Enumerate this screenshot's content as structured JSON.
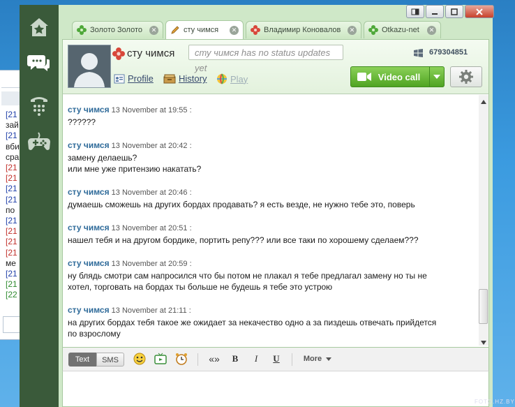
{
  "app": {
    "accent_green": "#5fb42f",
    "sidebar_color": "#3a5a3a",
    "nav": [
      {
        "name": "favorites-icon"
      },
      {
        "name": "chats-icon"
      },
      {
        "name": "phone-icon"
      },
      {
        "name": "games-icon"
      }
    ]
  },
  "tabs": [
    {
      "label": "Золото Золото",
      "icon": "status-online-icon",
      "active": false
    },
    {
      "label": "сту чимся",
      "icon": "pencil-icon",
      "active": true
    },
    {
      "label": "Владимир Коновалов",
      "icon": "status-busy-icon",
      "active": false
    },
    {
      "label": "Otkazu-net",
      "icon": "status-online-icon",
      "active": false
    }
  ],
  "contact": {
    "name": "сту чимся",
    "status_placeholder": "сту чимся has no status updates yet",
    "phone": "679304851",
    "links": {
      "profile": "Profile",
      "history": "History",
      "play": "Play"
    },
    "video_call": "Video call"
  },
  "messages": [
    {
      "author": "сту чимся",
      "time": "13 November at 19:55 :",
      "lines": [
        "??????"
      ]
    },
    {
      "author": "сту чимся",
      "time": "13 November at 20:42 :",
      "lines": [
        "замену делаешь?",
        "или мне уже притензию накатать?"
      ]
    },
    {
      "author": "сту чимся",
      "time": "13 November at 20:46 :",
      "lines": [
        "думаешь сможешь на других бордах продавать? я есть везде, не нужно тебе это, поверь"
      ]
    },
    {
      "author": "сту чимся",
      "time": "13 November at 20:51 :",
      "lines": [
        "нашел тебя и на другом бордике, портить репу??? или все таки по хорошему сделаем???"
      ]
    },
    {
      "author": "сту чимся",
      "time": "13 November at 20:59 :",
      "lines": [
        "ну блядь смотри сам напросился что бы потом не плакал я тебе предлагал замену но ты не",
        "хотел, торговать на бордах ты больше не будешь я тебе это устрою"
      ]
    },
    {
      "author": "сту чимся",
      "time": "13 November at 21:11 :",
      "lines": [
        "на других бордах тебя такое же ожидает за некачество одно а за пиздешь отвечать прийдется",
        "по взрослому"
      ]
    }
  ],
  "composer": {
    "mode_text": "Text",
    "mode_sms": "SMS",
    "format_quote": "«»",
    "format_bold": "B",
    "format_italic": "I",
    "format_underline": "U",
    "more": "More"
  },
  "background_window": {
    "lines": [
      {
        "text": "[21",
        "color": "#1f3fa8"
      },
      {
        "text": "зай",
        "color": "#222"
      },
      {
        "text": "[21",
        "color": "#1f3fa8"
      },
      {
        "text": "вби",
        "color": "#222"
      },
      {
        "text": "сра",
        "color": "#222"
      },
      {
        "text": "[21",
        "color": "#c0302a"
      },
      {
        "text": "[21",
        "color": "#c0302a"
      },
      {
        "text": "[21",
        "color": "#1f3fa8"
      },
      {
        "text": "[21",
        "color": "#1f3fa8"
      },
      {
        "text": "по",
        "color": "#222"
      },
      {
        "text": "[21",
        "color": "#1f3fa8"
      },
      {
        "text": "[21",
        "color": "#c0302a"
      },
      {
        "text": "[21",
        "color": "#c0302a"
      },
      {
        "text": "[21",
        "color": "#c0302a"
      },
      {
        "text": "ме",
        "color": "#222"
      },
      {
        "text": "[21",
        "color": "#1f3fa8"
      },
      {
        "text": "[21",
        "color": "#2e8a2e"
      },
      {
        "text": "[22",
        "color": "#2e8a2e"
      }
    ]
  },
  "watermark": "FOTO.HZ.BY"
}
